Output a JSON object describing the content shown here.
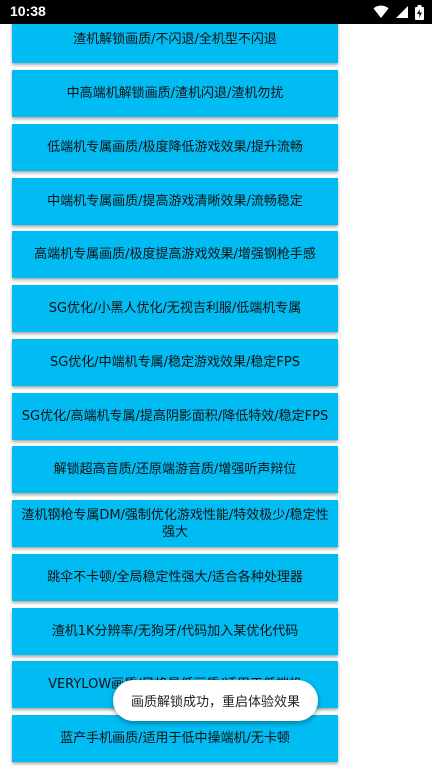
{
  "status_bar": {
    "time": "10:38",
    "icons": [
      "wifi-icon",
      "cellular-signal-icon",
      "battery-charging-icon"
    ]
  },
  "options": [
    {
      "label": "渣机解锁画质/不闪退/全机型不闪退"
    },
    {
      "label": "中高端机解锁画质/渣机闪退/渣机勿扰"
    },
    {
      "label": "低端机专属画质/极度降低游戏效果/提升流畅"
    },
    {
      "label": "中端机专属画质/提高游戏清晰效果/流畅稳定"
    },
    {
      "label": "高端机专属画质/极度提高游戏效果/增强钢枪手感"
    },
    {
      "label": "SG优化/小黑人优化/无视吉利服/低端机专属"
    },
    {
      "label": "SG优化/中端机专属/稳定游戏效果/稳定FPS"
    },
    {
      "label": "SG优化/高端机专属/提高阴影面积/降低特效/稳定FPS"
    },
    {
      "label": "解锁超高音质/还原端游音质/增强听声辩位"
    },
    {
      "label": "渣机钢枪专属DM/强制优化游戏性能/特效极少/稳定性强大"
    },
    {
      "label": "跳伞不卡顿/全局稳定性强大/适合各种处理器"
    },
    {
      "label": "渣机1K分辨率/无狗牙/代码加入某优化代码"
    },
    {
      "label": "VERYLOW画质/风格最低画质/适用于低端机"
    },
    {
      "label": "蓝产手机画质/适用于低中操端机/无卡顿"
    }
  ],
  "toast": {
    "message": "画质解锁成功，重启体验效果"
  },
  "colors": {
    "button": "#00BCF2",
    "status_bar": "#000000",
    "background": "#FFFFFF"
  }
}
